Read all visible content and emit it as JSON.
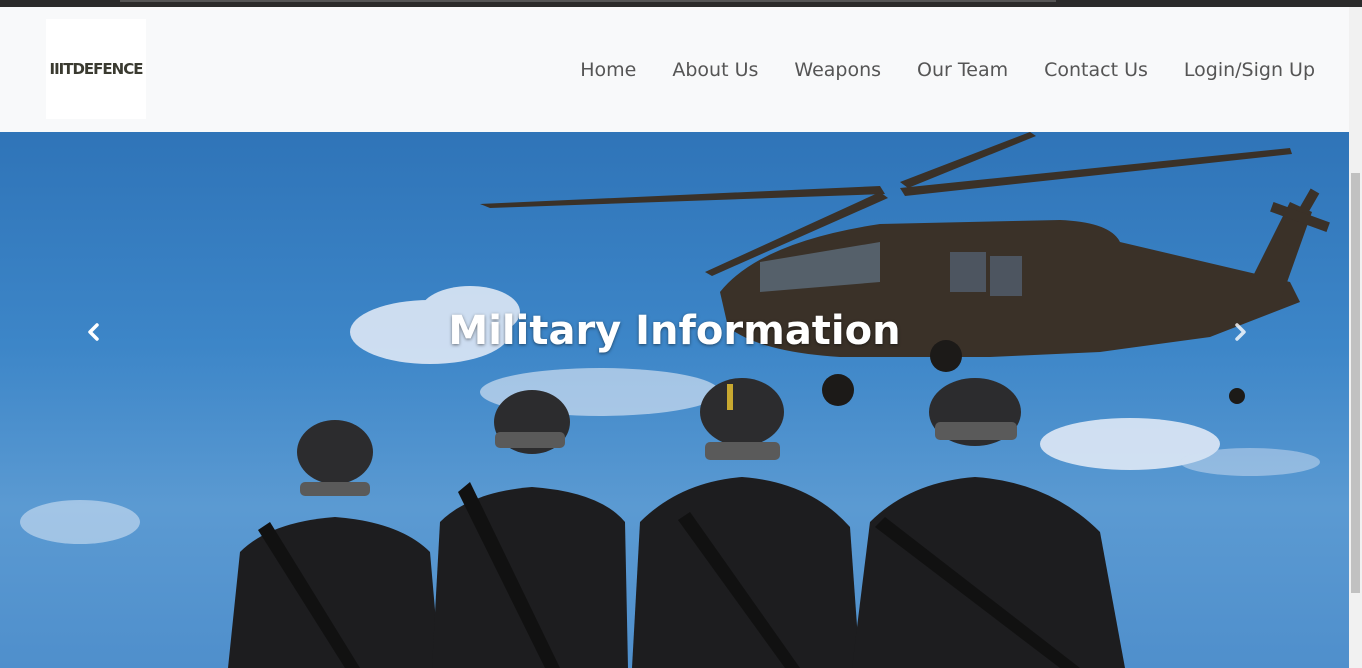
{
  "brand": {
    "logo_text": "IIITDEFENCE"
  },
  "nav": {
    "items": [
      "Home",
      "About Us",
      "Weapons",
      "Our Team",
      "Contact Us",
      "Login/Sign Up"
    ]
  },
  "carousel": {
    "caption": "Military Information"
  },
  "colors": {
    "navbar_bg": "#f8f9fa",
    "nav_text": "#555555",
    "caption_text": "#ffffff",
    "sky": "#3d86c8"
  }
}
